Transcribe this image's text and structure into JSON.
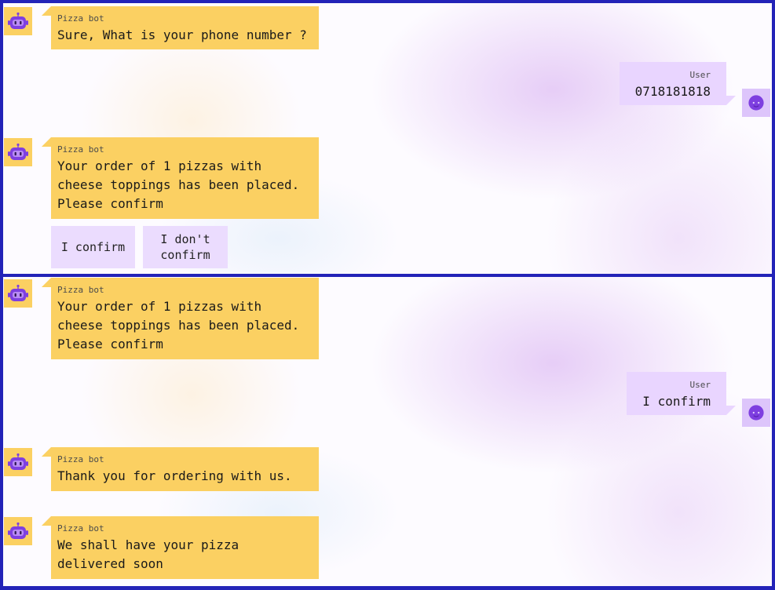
{
  "colors": {
    "frame": "#2323b8",
    "bot_bubble": "#fbd062",
    "user_bubble": "#e9d5ff",
    "user_avatar_bg": "#ddc5fb",
    "robot_icon": "#7e3fe0",
    "option_button": "#ebdcfe"
  },
  "icons": {
    "bot_avatar": "robot-icon",
    "user_avatar": "face-icon"
  },
  "panel1": {
    "messages": [
      {
        "sender": "Pizza bot",
        "text": "Sure, What is your phone number ?"
      },
      {
        "sender": "User",
        "text": "0718181818"
      },
      {
        "sender": "Pizza bot",
        "text": "Your order of 1 pizzas with\ncheese toppings has been placed.\nPlease confirm"
      }
    ],
    "options": [
      "I confirm",
      "I don't\nconfirm"
    ]
  },
  "panel2": {
    "messages": [
      {
        "sender": "Pizza bot",
        "text": "Your order of 1 pizzas with\ncheese toppings has been placed.\nPlease confirm"
      },
      {
        "sender": "User",
        "text": "I confirm"
      },
      {
        "sender": "Pizza bot",
        "text": "Thank you for ordering with us."
      },
      {
        "sender": "Pizza bot",
        "text": "We shall have your pizza\ndelivered soon"
      }
    ]
  }
}
